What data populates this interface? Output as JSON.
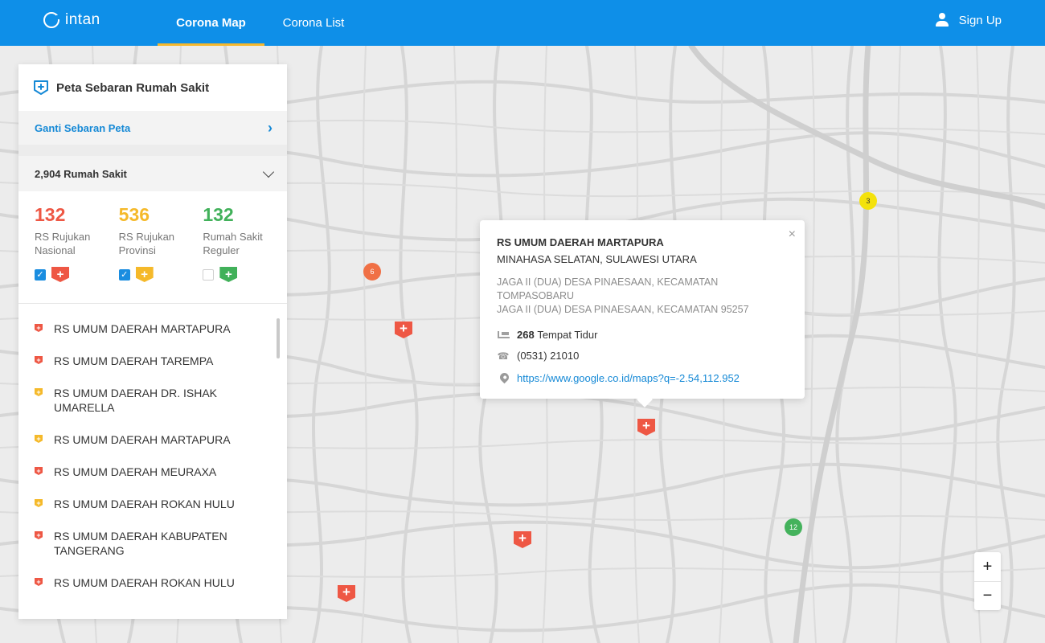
{
  "header": {
    "logo": "intan",
    "nav": [
      "Corona Map",
      "Corona List"
    ],
    "signup": "Sign Up"
  },
  "panel": {
    "title": "Peta Sebaran Rumah Sakit",
    "change_map": "Ganti Sebaran Peta",
    "summary": "2,904 Rumah Sakit",
    "stats": [
      {
        "value": "132",
        "label": "RS Rujukan Nasional",
        "color": "#ee5744",
        "checked": true
      },
      {
        "value": "536",
        "label": "RS Rujukan Provinsi",
        "color": "#f5b92a",
        "checked": true
      },
      {
        "value": "132",
        "label": "Rumah Sakit Reguler",
        "color": "#41b15a",
        "checked": false
      }
    ],
    "hospitals": [
      {
        "name": "RS UMUM DAERAH MARTAPURA",
        "type": "nasional"
      },
      {
        "name": "RS UMUM DAERAH TAREMPA",
        "type": "nasional"
      },
      {
        "name": "RS UMUM DAERAH DR. ISHAK UMARELLA",
        "type": "provinsi"
      },
      {
        "name": "RS UMUM DAERAH MARTAPURA",
        "type": "provinsi"
      },
      {
        "name": "RS UMUM DAERAH MEURAXA",
        "type": "nasional"
      },
      {
        "name": "RS UMUM DAERAH ROKAN HULU",
        "type": "provinsi"
      },
      {
        "name": "RS UMUM DAERAH KABUPATEN TANGERANG",
        "type": "nasional"
      },
      {
        "name": "RS UMUM DAERAH ROKAN HULU",
        "type": "nasional"
      }
    ]
  },
  "popup": {
    "title": "RS UMUM DAERAH MARTAPURA",
    "region": "MINAHASA SELATAN, SULAWESI UTARA",
    "address_1": "JAGA II (DUA) DESA PINAESAAN, KECAMATAN TOMPASOBARU",
    "address_2": "JAGA II (DUA) DESA PINAESAAN, KECAMATAN 95257",
    "beds": "268",
    "beds_label": "Tempat Tidur",
    "phone": "(0531) 21010",
    "maps_link": "https://www.google.co.id/maps?q=-2.54,112.952"
  },
  "clusters": [
    {
      "count": "6",
      "color": "#f07045"
    },
    {
      "count": "3",
      "color": "#f4e20c"
    },
    {
      "count": "12",
      "color": "#44b25c"
    }
  ],
  "colors": {
    "primary": "#0e8fe8",
    "accent": "#f5b82e",
    "nasional": "#ee5744",
    "provinsi": "#f5b92a",
    "reguler": "#41b15a"
  },
  "zoom": {
    "in": "+",
    "out": "−"
  }
}
